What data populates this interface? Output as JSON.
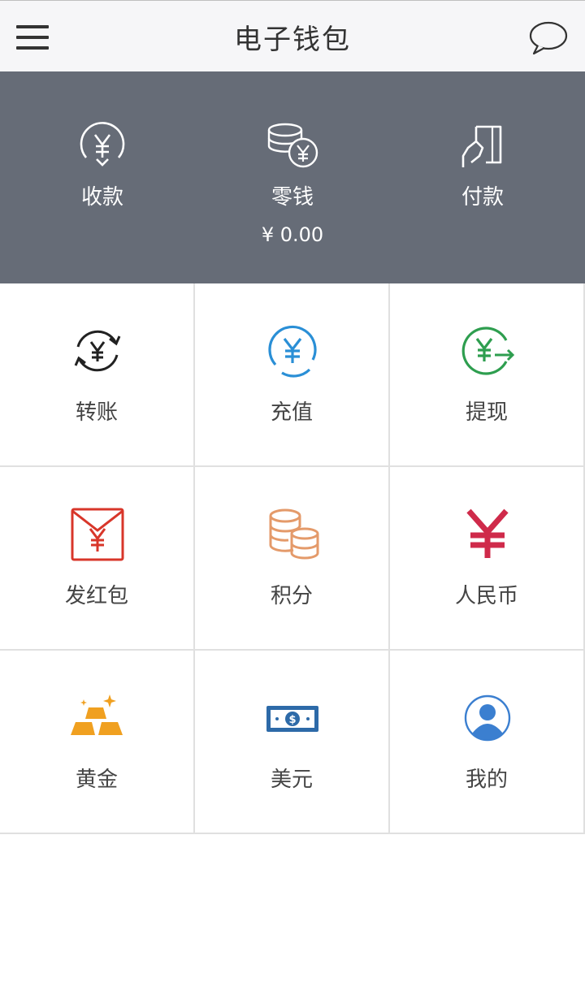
{
  "header": {
    "title": "电子钱包",
    "menu_icon": "hamburger-menu-icon",
    "chat_icon": "speech-bubble-icon"
  },
  "banner": {
    "items": [
      {
        "label": "收款",
        "icon": "yuan-receive-icon"
      },
      {
        "label": "零钱",
        "icon": "coins-yuan-icon",
        "value": "¥ 0.00"
      },
      {
        "label": "付款",
        "icon": "card-pay-icon"
      }
    ],
    "background": "#666c77"
  },
  "grid": {
    "items": [
      {
        "label": "转账",
        "icon": "transfer-yuan-icon",
        "color": "#222222"
      },
      {
        "label": "充值",
        "icon": "recharge-yuan-icon",
        "color": "#2a8fd6"
      },
      {
        "label": "提现",
        "icon": "withdraw-yuan-icon",
        "color": "#2e9e4f"
      },
      {
        "label": "发红包",
        "icon": "red-envelope-icon",
        "color": "#d8362a"
      },
      {
        "label": "积分",
        "icon": "points-coins-icon",
        "color": "#e49a6a"
      },
      {
        "label": "人民币",
        "icon": "rmb-yuan-icon",
        "color": "#cf2a4a"
      },
      {
        "label": "黄金",
        "icon": "gold-bars-icon",
        "color": "#f0a020"
      },
      {
        "label": "美元",
        "icon": "dollar-bill-icon",
        "color": "#2d6aa8"
      },
      {
        "label": "我的",
        "icon": "user-profile-icon",
        "color": "#3b7fd0"
      }
    ]
  }
}
